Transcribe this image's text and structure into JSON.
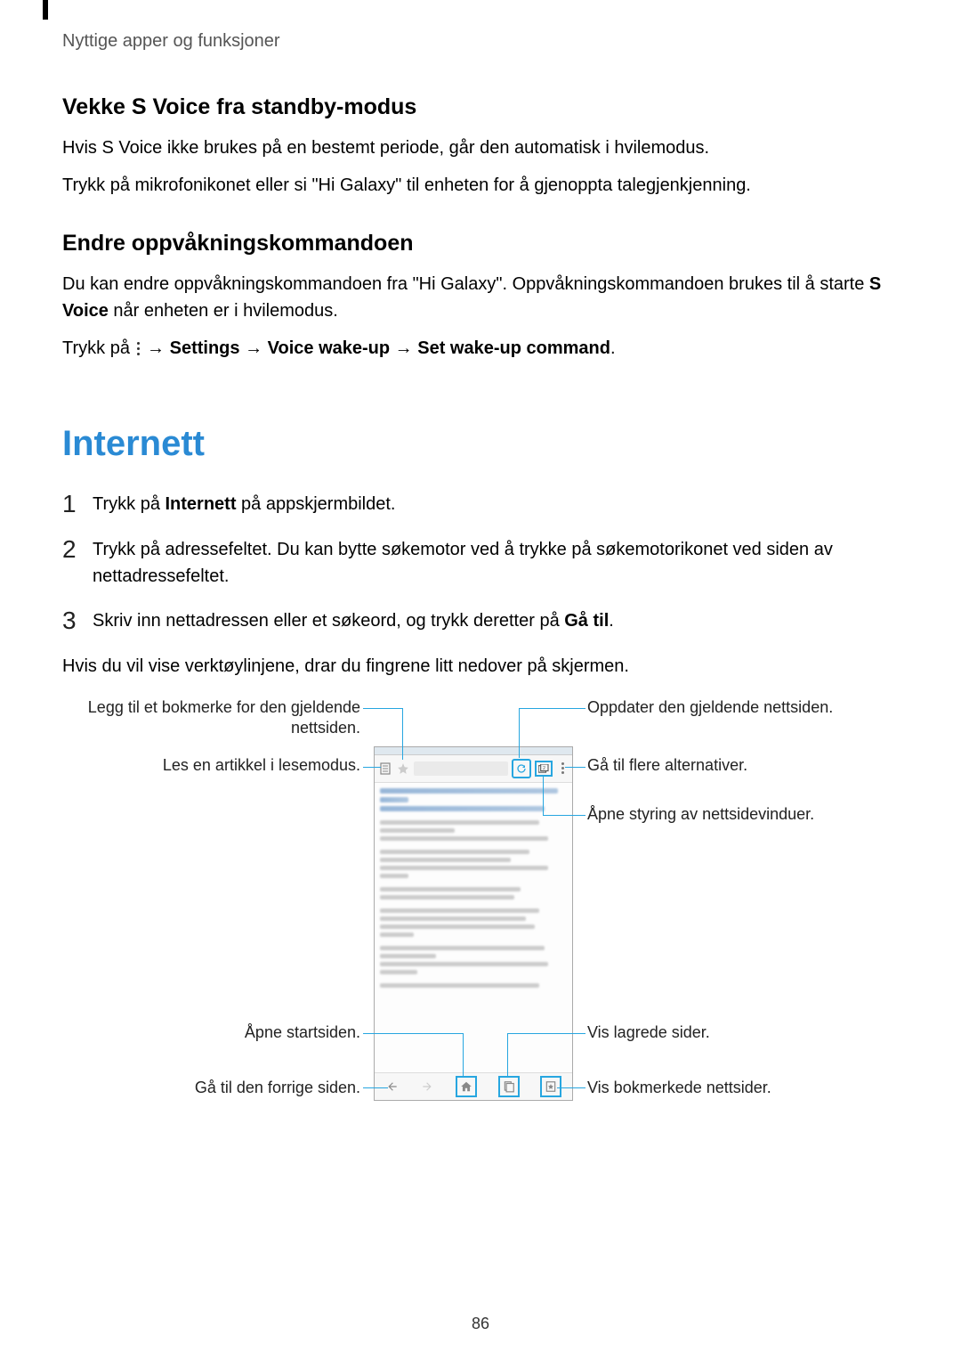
{
  "header": "Nyttige apper og funksjoner",
  "section1": {
    "title": "Vekke S Voice fra standby-modus",
    "p1": "Hvis S Voice ikke brukes på en bestemt periode, går den automatisk i hvilemodus.",
    "p2": "Trykk på mikrofonikonet eller si \"Hi Galaxy\" til enheten for å gjenoppta talegjenkjenning."
  },
  "section2": {
    "title": "Endre oppvåkningskommandoen",
    "p1_a": "Du kan endre oppvåkningskommandoen fra \"Hi Galaxy\". Oppvåkningskommandoen brukes til å starte ",
    "p1_b": "S Voice",
    "p1_c": " når enheten er i hvilemodus.",
    "p2_a": "Trykk på ",
    "p2_b": " → ",
    "p2_c": "Settings",
    "p2_d": " → ",
    "p2_e": "Voice wake-up",
    "p2_f": " → ",
    "p2_g": "Set wake-up command",
    "p2_h": "."
  },
  "internett": {
    "title": "Internett",
    "step1_a": "Trykk på ",
    "step1_b": "Internett",
    "step1_c": " på appskjermbildet.",
    "step2": "Trykk på adressefeltet. Du kan bytte søkemotor ved å trykke på søkemotorikonet ved siden av nettadressefeltet.",
    "step3_a": "Skriv inn nettadressen eller et søkeord, og trykk deretter på ",
    "step3_b": "Gå til",
    "step3_c": ".",
    "after": "Hvis du vil vise verktøylinjene, drar du fingrene litt nedover på skjermen."
  },
  "callouts": {
    "bookmark": "Legg til et bokmerke for den gjeldende nettsiden.",
    "reader": "Les en artikkel i lesemodus.",
    "home": "Åpne startsiden.",
    "back": "Gå til den forrige siden.",
    "refresh": "Oppdater den gjeldende nettsiden.",
    "more": "Gå til flere alternativer.",
    "windows": "Åpne styring av nettsidevinduer.",
    "saved": "Vis lagrede sider.",
    "bookmarked": "Vis bokmerkede nettsider."
  },
  "page_number": "86"
}
